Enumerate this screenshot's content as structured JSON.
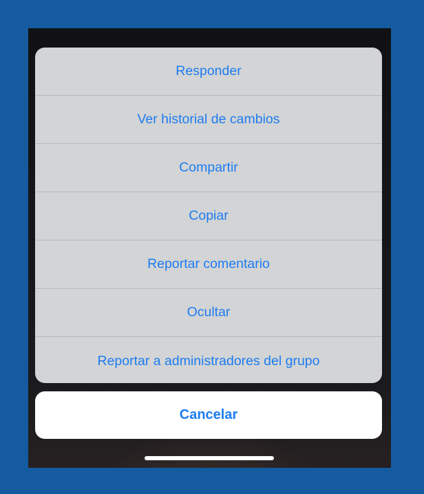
{
  "action_sheet": {
    "items": [
      {
        "label": "Responder"
      },
      {
        "label": "Ver historial de cambios"
      },
      {
        "label": "Compartir"
      },
      {
        "label": "Copiar"
      },
      {
        "label": "Reportar comentario"
      },
      {
        "label": "Ocultar"
      },
      {
        "label": "Reportar a administradores del grupo"
      }
    ],
    "cancel_label": "Cancelar"
  },
  "colors": {
    "page_background": "#145b9f",
    "sheet_background": "#d3d4d5",
    "action_text": "#1d7cf2",
    "cancel_background": "#ffffff"
  }
}
